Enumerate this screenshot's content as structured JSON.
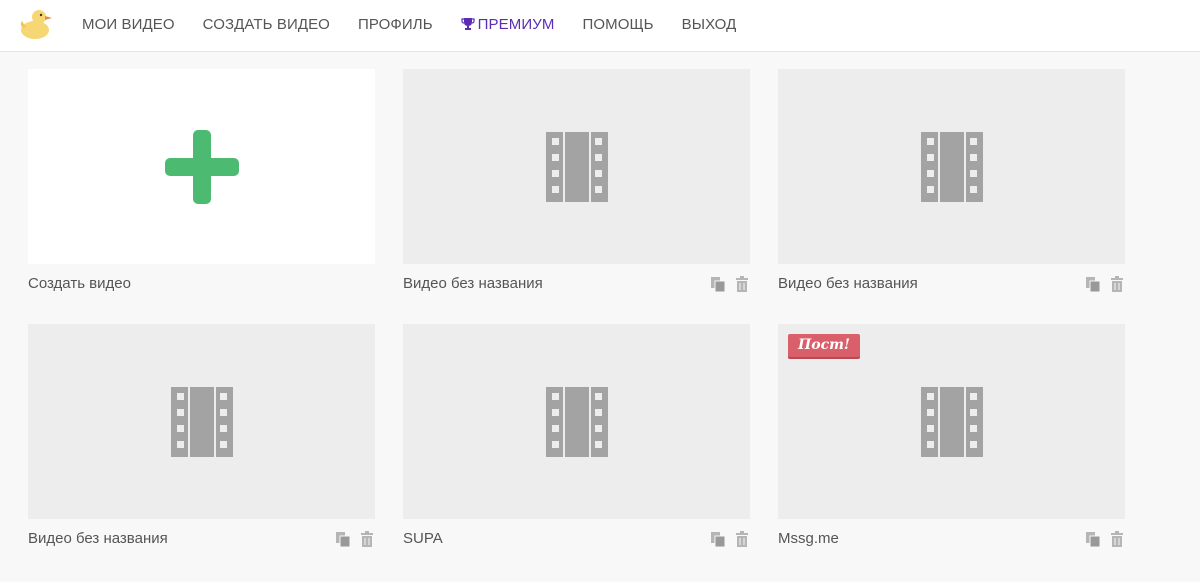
{
  "header": {
    "logo_icon": "duck-logo-icon",
    "nav": [
      {
        "label": "МОИ ВИДЕО",
        "name": "nav-my-videos"
      },
      {
        "label": "СОЗДАТЬ ВИДЕО",
        "name": "nav-create-video"
      },
      {
        "label": "ПРОФИЛЬ",
        "name": "nav-profile"
      },
      {
        "label": "ПРЕМИУМ",
        "name": "nav-premium",
        "icon": "trophy-icon"
      },
      {
        "label": "ПОМОЩЬ",
        "name": "nav-help"
      },
      {
        "label": "ВЫХОД",
        "name": "nav-logout"
      }
    ]
  },
  "colors": {
    "accent_premium": "#5b2db5",
    "plus_green": "#4cbb71",
    "badge_red": "#d9606b",
    "thumb_bg": "#ededed",
    "film_gray": "#a3a3a3"
  },
  "videos": [
    {
      "title": "Создать видео",
      "type": "create",
      "icon": "plus-icon"
    },
    {
      "title": "Видео без названия",
      "icon": "film-icon"
    },
    {
      "title": "Видео без названия",
      "icon": "film-icon"
    },
    {
      "title": "Видео без названия",
      "icon": "film-icon"
    },
    {
      "title": "SUPA",
      "icon": "film-icon"
    },
    {
      "title": "Mssg.me",
      "icon": "film-icon",
      "badge": "Пост!"
    }
  ]
}
